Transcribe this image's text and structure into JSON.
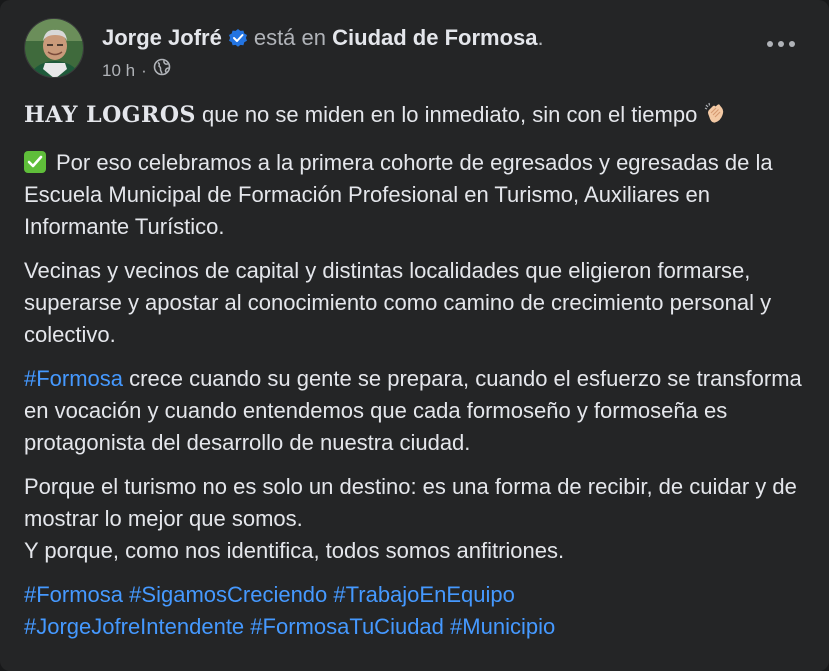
{
  "post": {
    "author": "Jorge Jofré",
    "connector": "está en",
    "place": "Ciudad de Formosa",
    "place_suffix": ".",
    "time": "10 h",
    "separator": "·",
    "icons": {
      "verified": "verified-badge-icon",
      "audience": "globe-icon",
      "menu": "more-options-icon",
      "clap": "clapping-hands-emoji",
      "check": "check-mark-emoji"
    },
    "colors": {
      "background": "#242526",
      "text": "#e4e6eb",
      "muted": "#b0b3b8",
      "link": "#4599ff",
      "verified": "#2374e1",
      "check": "#5fbe3a"
    }
  },
  "content": {
    "p1_bold": "HAY LOGROS",
    "p1_rest": " que no se miden en lo inmediato, sin con el tiempo ",
    "p2": "Por eso celebramos a la primera cohorte de egresados y egresadas de la Escuela Municipal de Formación Profesional en Turismo, Auxiliares en Informante Turístico.",
    "p3": "Vecinas y vecinos de capital y distintas localidades que eligieron formarse, superarse y apostar al conocimiento como camino de crecimiento personal y colectivo.",
    "p4_tag": "#Formosa",
    "p4_rest": " crece cuando su gente se prepara, cuando el esfuerzo se transforma en vocación y cuando entendemos que cada formoseño y formoseña es protagonista del desarrollo de nuestra ciudad.",
    "p5_line1": "Porque el turismo no es solo un destino: es una forma de recibir, de cuidar y de mostrar lo mejor que somos.",
    "p5_line2": "Y porque, como nos identifica, todos somos anfitriones.",
    "hashtags": [
      "#Formosa",
      "#SigamosCreciendo",
      "#TrabajoEnEquipo",
      "#JorgeJofreIntendente",
      "#FormosaTuCiudad",
      "#Municipio"
    ]
  }
}
